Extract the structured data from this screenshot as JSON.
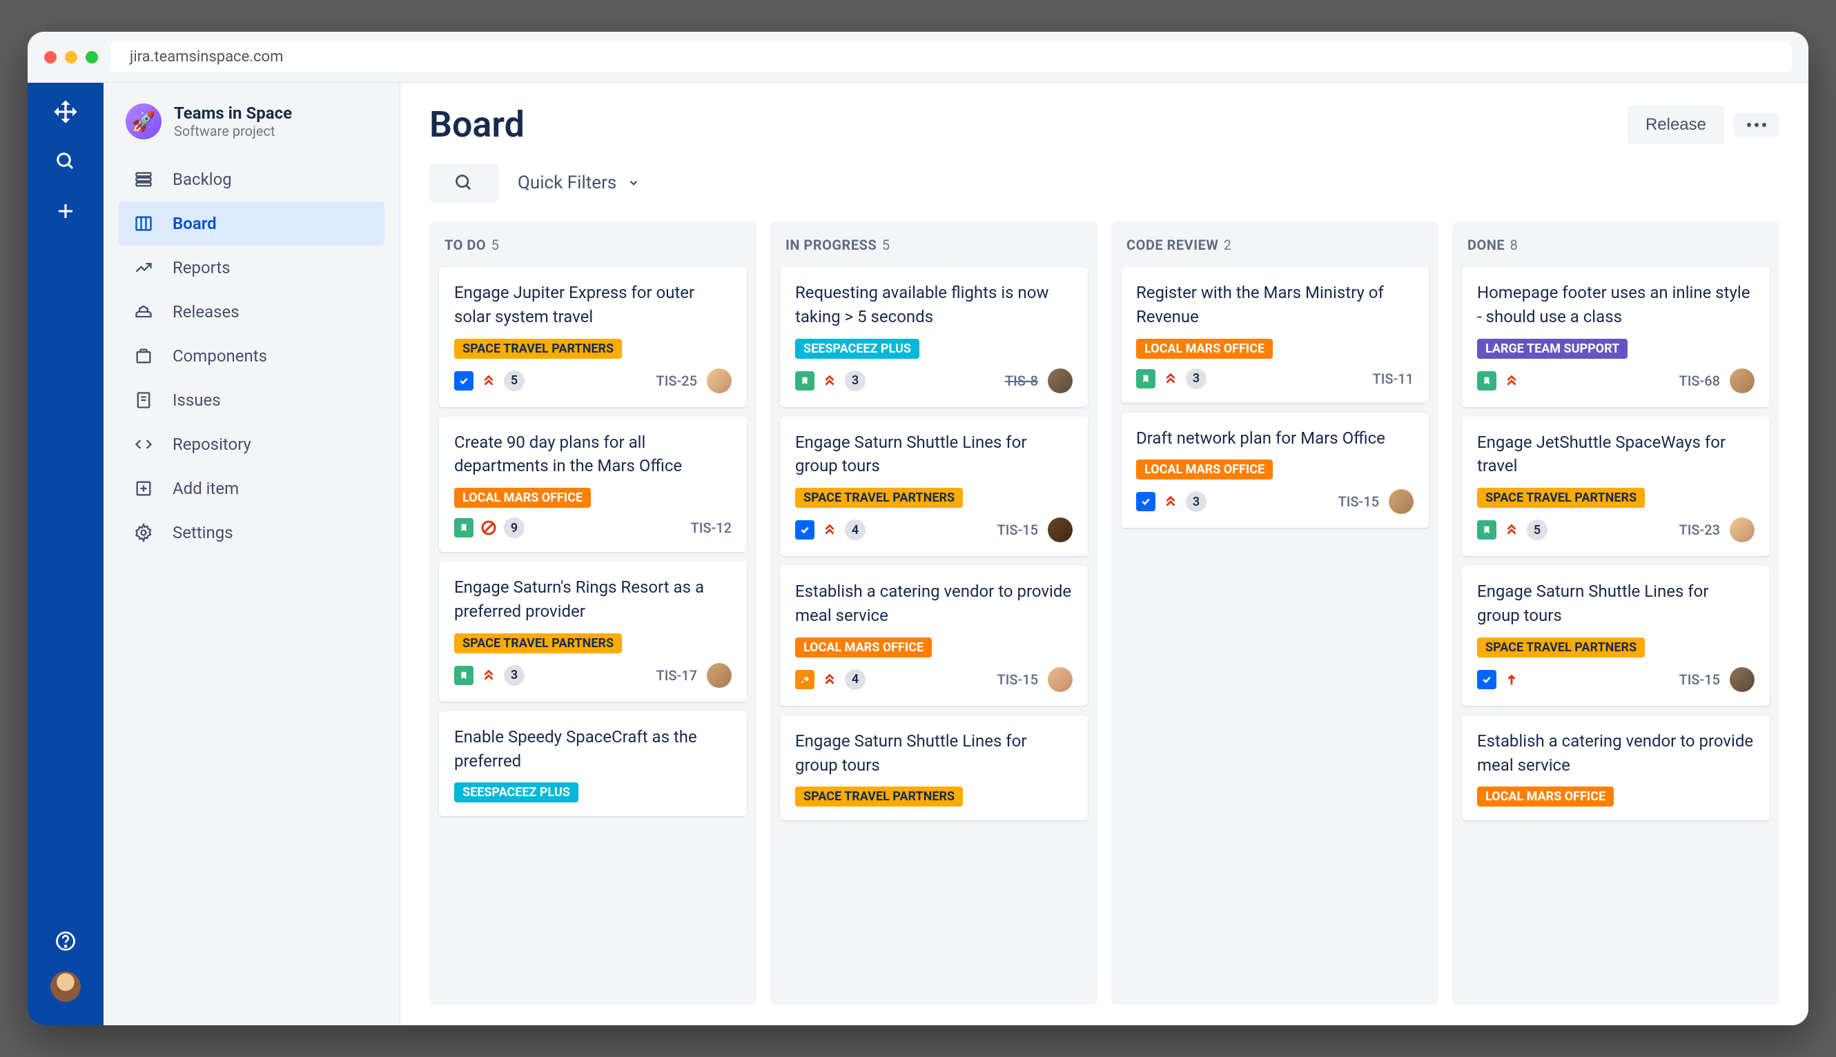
{
  "browser": {
    "url": "jira.teamsinspace.com"
  },
  "project": {
    "name": "Teams in Space",
    "type": "Software project"
  },
  "sidebar": {
    "items": [
      {
        "label": "Backlog"
      },
      {
        "label": "Board"
      },
      {
        "label": "Reports"
      },
      {
        "label": "Releases"
      },
      {
        "label": "Components"
      },
      {
        "label": "Issues"
      },
      {
        "label": "Repository"
      },
      {
        "label": "Add item"
      },
      {
        "label": "Settings"
      }
    ]
  },
  "page": {
    "title": "Board",
    "release_label": "Release",
    "quick_filters_label": "Quick Filters"
  },
  "columns": [
    {
      "name": "TO DO",
      "count": "5",
      "cards": [
        {
          "title": "Engage Jupiter Express for outer solar system travel",
          "tag": "SPACE TRAVEL PARTNERS",
          "tag_color": "yellow",
          "type": "task",
          "priority": "highest",
          "points": "5",
          "key": "TIS-25",
          "avatar": "av1"
        },
        {
          "title": "Create 90 day plans for all departments in the Mars Office",
          "tag": "LOCAL MARS OFFICE",
          "tag_color": "orange",
          "type": "story",
          "priority": "blocked",
          "points": "9",
          "key": "TIS-12",
          "avatar": null
        },
        {
          "title": "Engage Saturn's Rings Resort as a preferred provider",
          "tag": "SPACE TRAVEL PARTNERS",
          "tag_color": "yellow",
          "type": "story",
          "priority": "highest",
          "points": "3",
          "key": "TIS-17",
          "avatar": "av3"
        },
        {
          "title": "Enable Speedy SpaceCraft as the preferred",
          "tag": "SEESPACEEZ PLUS",
          "tag_color": "teal",
          "type": null,
          "priority": null,
          "points": null,
          "key": null,
          "avatar": null
        }
      ]
    },
    {
      "name": "IN PROGRESS",
      "count": "5",
      "cards": [
        {
          "title": "Requesting available flights is now taking > 5 seconds",
          "tag": "SEESPACEEZ PLUS",
          "tag_color": "teal",
          "type": "story-green",
          "priority": "highest",
          "points": "3",
          "key": "TIS-8",
          "key_strike": true,
          "avatar": "av2"
        },
        {
          "title": "Engage Saturn Shuttle Lines for group tours",
          "tag": "SPACE TRAVEL PARTNERS",
          "tag_color": "yellow",
          "type": "task",
          "priority": "highest",
          "points": "4",
          "key": "TIS-15",
          "avatar": "av4"
        },
        {
          "title": "Establish a catering vendor to provide meal service",
          "tag": "LOCAL MARS OFFICE",
          "tag_color": "orange",
          "type": "tool",
          "priority": "highest",
          "points": "4",
          "key": "TIS-15",
          "avatar": "av5"
        },
        {
          "title": "Engage Saturn Shuttle Lines for group tours",
          "tag": "SPACE TRAVEL PARTNERS",
          "tag_color": "yellow",
          "type": null,
          "priority": null,
          "points": null,
          "key": null,
          "avatar": null
        }
      ]
    },
    {
      "name": "CODE REVIEW",
      "count": "2",
      "cards": [
        {
          "title": "Register with the Mars Ministry of Revenue",
          "tag": "LOCAL MARS OFFICE",
          "tag_color": "orange",
          "type": "story-green",
          "priority": "highest",
          "points": "3",
          "key": "TIS-11",
          "avatar": null
        },
        {
          "title": "Draft network plan for Mars Office",
          "tag": "LOCAL MARS OFFICE",
          "tag_color": "orange",
          "type": "task",
          "priority": "highest",
          "points": "3",
          "key": "TIS-15",
          "avatar": "av3"
        }
      ]
    },
    {
      "name": "DONE",
      "count": "8",
      "cards": [
        {
          "title": "Homepage footer uses an inline style - should use a class",
          "tag": "LARGE TEAM SUPPORT",
          "tag_color": "purple",
          "type": "story",
          "priority": "highest",
          "points": null,
          "key": "TIS-68",
          "avatar": "av3"
        },
        {
          "title": "Engage JetShuttle SpaceWays for travel",
          "tag": "SPACE TRAVEL PARTNERS",
          "tag_color": "yellow",
          "type": "story-green",
          "priority": "highest",
          "points": "5",
          "key": "TIS-23",
          "avatar": "av1"
        },
        {
          "title": "Engage Saturn Shuttle Lines for group tours",
          "tag": "SPACE TRAVEL PARTNERS",
          "tag_color": "yellow",
          "type": "task",
          "priority": "high-single",
          "points": null,
          "key": "TIS-15",
          "avatar": "av2"
        },
        {
          "title": "Establish a catering vendor to provide meal service",
          "tag": "LOCAL MARS OFFICE",
          "tag_color": "orange",
          "type": null,
          "priority": null,
          "points": null,
          "key": null,
          "avatar": null
        }
      ]
    }
  ]
}
